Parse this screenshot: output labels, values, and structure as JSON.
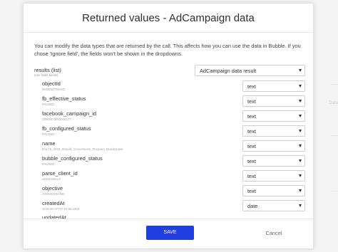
{
  "dialog": {
    "title": "Returned values - AdCampaign data",
    "description": "You can modify the data types that are returned by the call. This affects how you can use the data in Bubble. If you chose 'Ignore field', the fields won't be shown in the dropdowns.",
    "results_label": "results (list)",
    "results_sublabel": "(see fields below)",
    "results_type": "AdCampaign data result",
    "fields": [
      {
        "name": "objectId",
        "sample": "BHWDdfTMAVO",
        "type": "text"
      },
      {
        "name": "fb_effective_status",
        "sample": "PAUSED",
        "type": "text"
      },
      {
        "name": "facebook_campaign_id",
        "sample": "23843073951016177",
        "type": "text"
      },
      {
        "name": "fb_configured_status",
        "sample": "PAUSED",
        "type": "text"
      },
      {
        "name": "name",
        "sample": "DALI'S_2018_Shopify_Conversions_Prospect_Moodcruiser",
        "type": "text"
      },
      {
        "name": "bubble_configured_status",
        "sample": "PAUSED",
        "type": "text"
      },
      {
        "name": "parse_client_id",
        "sample": "oZJUhvmbLd",
        "type": "text"
      },
      {
        "name": "objective",
        "sample": "CONVERSIONS",
        "type": "text"
      },
      {
        "name": "createdAt",
        "sample": "2018-05-07T07:51:56.430Z",
        "type": "date"
      },
      {
        "name": "updatedAt",
        "sample": "",
        "type": ""
      }
    ],
    "save_label": "SAVE",
    "cancel_label": "Cancel"
  },
  "background": {
    "right_text": "Data"
  },
  "colors": {
    "primary_button": "#1f3fe0",
    "modal_bg": "#ffffff"
  }
}
